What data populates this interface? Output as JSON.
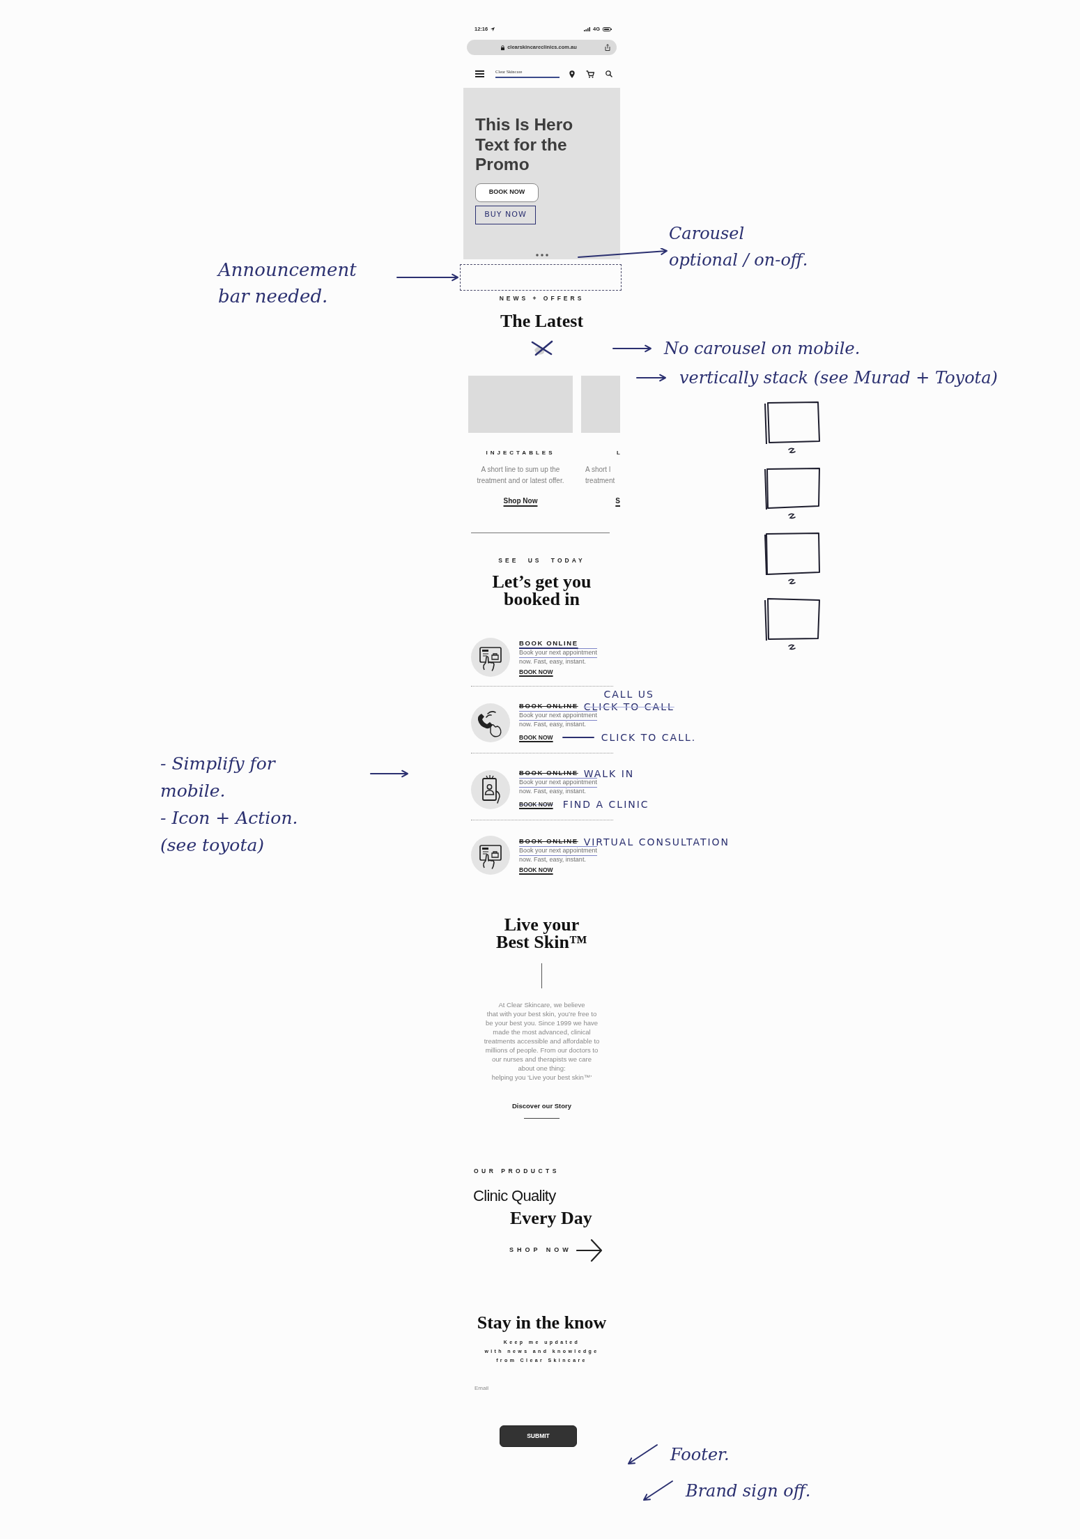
{
  "status_bar": {
    "time": "12:16",
    "network": "4G"
  },
  "browser": {
    "url": "clearskincareclinics.com.au"
  },
  "header": {
    "logo": "Clear Skincare"
  },
  "hero": {
    "heading_lines": [
      "This Is Hero",
      "Text for the",
      "Promo"
    ],
    "button": "BOOK NOW",
    "sketched_button": "BUY NOW",
    "note": [
      "Carousel",
      "optional / on-off."
    ]
  },
  "announcement_bar": {
    "note": [
      "Announcement",
      "bar needed."
    ]
  },
  "latest": {
    "eyebrow": "NEWS + OFFERS",
    "heading": "The Latest",
    "notes": [
      "No carousel on mobile.",
      "vertically stack (see Murad + Toyota)"
    ],
    "cards": [
      {
        "category": "INJECTABLES",
        "description_lines": [
          "A short line to sum up the",
          "treatment and or latest offer."
        ],
        "link": "Shop Now"
      },
      {
        "category": "L",
        "description_lines": [
          "A short l",
          "treatment"
        ],
        "link": "S"
      }
    ]
  },
  "booking": {
    "eyebrow": "SEE US TODAY",
    "heading_lines": [
      "Let’s get you",
      "booked in"
    ],
    "note": [
      "- Simplify for",
      "mobile.",
      "- Icon + Action.",
      "(see toyota)"
    ],
    "options": [
      {
        "kind": "tablet",
        "title": "BOOK ONLINE",
        "title_underlined": true,
        "title_struck": false,
        "description_lines": [
          "Book your next appointment",
          "now. Fast, easy, instant."
        ],
        "description_struck": true,
        "link": "BOOK NOW",
        "link_struck": false
      },
      {
        "kind": "handset",
        "title": "BOOK ONLINE",
        "title_underlined": false,
        "title_struck": true,
        "title_notes": [
          {
            "text": "CALL US",
            "struck": false
          },
          {
            "text": "CLICK TO CALL",
            "struck": true
          }
        ],
        "description_lines": [
          "Book your next appointment",
          "now. Fast, easy, instant."
        ],
        "description_struck": true,
        "link": "BOOK NOW",
        "link_struck": false,
        "link_note": {
          "text": "CLICK TO CALL.",
          "leader": true
        }
      },
      {
        "kind": "mobile",
        "title": "BOOK ONLINE",
        "title_underlined": false,
        "title_struck": true,
        "title_notes": [
          {
            "text": "WALK IN",
            "struck": false
          }
        ],
        "description_lines": [
          "Book your next appointment",
          "now. Fast, easy, instant."
        ],
        "description_struck": true,
        "link": "BOOK NOW",
        "link_struck": true,
        "link_note": {
          "text": "FIND A CLINIC"
        }
      },
      {
        "kind": "tablet",
        "title": "BOOK ONLINE",
        "title_underlined": false,
        "title_struck": true,
        "title_notes": [
          {
            "text": "VIRTUAL CONSULTATION",
            "struck": false
          }
        ],
        "description_lines": [
          "Book your next appointment",
          "now. Fast, easy, instant."
        ],
        "description_struck": true,
        "link": "BOOK NOW",
        "link_struck": false
      }
    ]
  },
  "story": {
    "heading_lines": [
      "Live your",
      "Best Skin™"
    ],
    "body_lines": [
      "At Clear Skincare, we believe",
      "that with your best skin, you’re free to",
      "be your best you. Since 1999 we have",
      "made the most advanced, clinical",
      "treatments accessible and affordable to",
      "millions of people. From our doctors to",
      "our nurses and therapists we care",
      "about one thing:",
      "helping you ‘Live your best skin™’"
    ],
    "link": "Discover our Story"
  },
  "products": {
    "eyebrow": "OUR PRODUCTS",
    "heading_lines": [
      "Clinic Quality",
      "Every Day"
    ],
    "link": "SHOP NOW"
  },
  "newsletter": {
    "heading": "Stay in the know",
    "text_lines": [
      "Keep me updated",
      "with news and knowledge",
      "from Clear Skincare"
    ],
    "email": {
      "placeholder": "Email"
    },
    "button": "SUBMIT"
  },
  "footer_notes": [
    "Footer.",
    "Brand sign off."
  ]
}
